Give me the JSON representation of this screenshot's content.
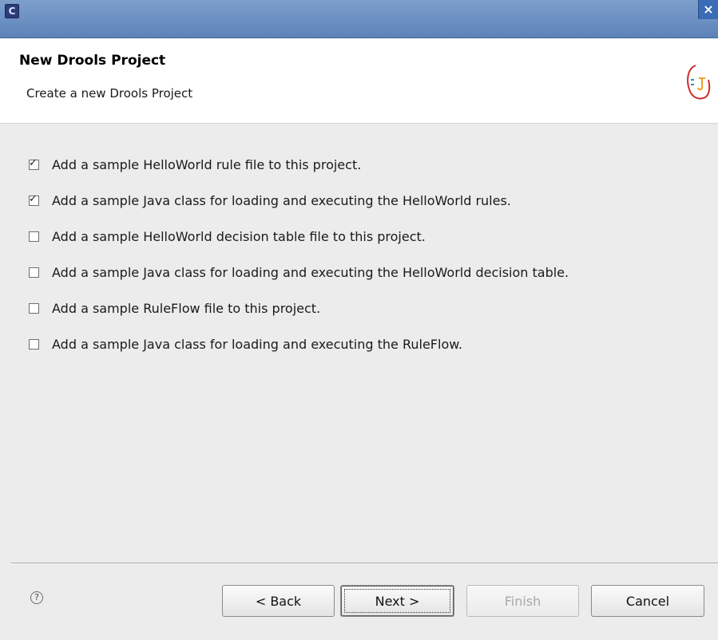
{
  "window": {
    "close_glyph": "×",
    "icon": "eclipse-icon"
  },
  "header": {
    "title": "New Drools Project",
    "description": "Create a new Drools Project",
    "logo": "drools-logo-icon"
  },
  "options": [
    {
      "label": "Add a sample HelloWorld rule file to this project.",
      "checked": true
    },
    {
      "label": "Add a sample Java class for loading and executing the HelloWorld rules.",
      "checked": true
    },
    {
      "label": "Add a sample HelloWorld decision table file to this project.",
      "checked": false
    },
    {
      "label": "Add a sample Java class for loading and executing the HelloWorld decision table.",
      "checked": false
    },
    {
      "label": "Add a sample RuleFlow file to this project.",
      "checked": false
    },
    {
      "label": "Add a sample Java class for loading and executing the RuleFlow.",
      "checked": false
    }
  ],
  "footer": {
    "help_glyph": "?",
    "back_label": "< Back",
    "next_label": "Next >",
    "finish_label": "Finish",
    "cancel_label": "Cancel"
  }
}
